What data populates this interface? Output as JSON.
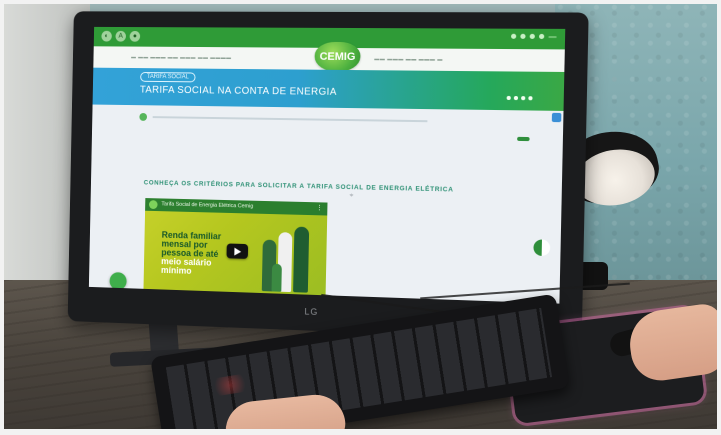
{
  "screen": {
    "site_logo": "CEMIG",
    "banner_pill": "TARIFA SOCIAL",
    "banner_title": "TARIFA SOCIAL NA CONTA DE ENERGIA",
    "section_title": "CONHEÇA OS CRITÉRIOS PARA SOLICITAR A TARIFA SOCIAL DE ENERGIA ELÉTRICA",
    "video": {
      "title": "Tarifa Social de Energia Elétrica Cemig",
      "text_line1": "Renda familiar",
      "text_line2": "mensal por",
      "text_line3": "pessoa de até",
      "text_line4": "meio salário",
      "text_line5": "mínimo"
    }
  },
  "monitor": {
    "brand": "LG"
  },
  "colors": {
    "brand_green": "#2f9b37",
    "banner_blue": "#2d9fcf",
    "video_yellow": "#c7d12b"
  }
}
